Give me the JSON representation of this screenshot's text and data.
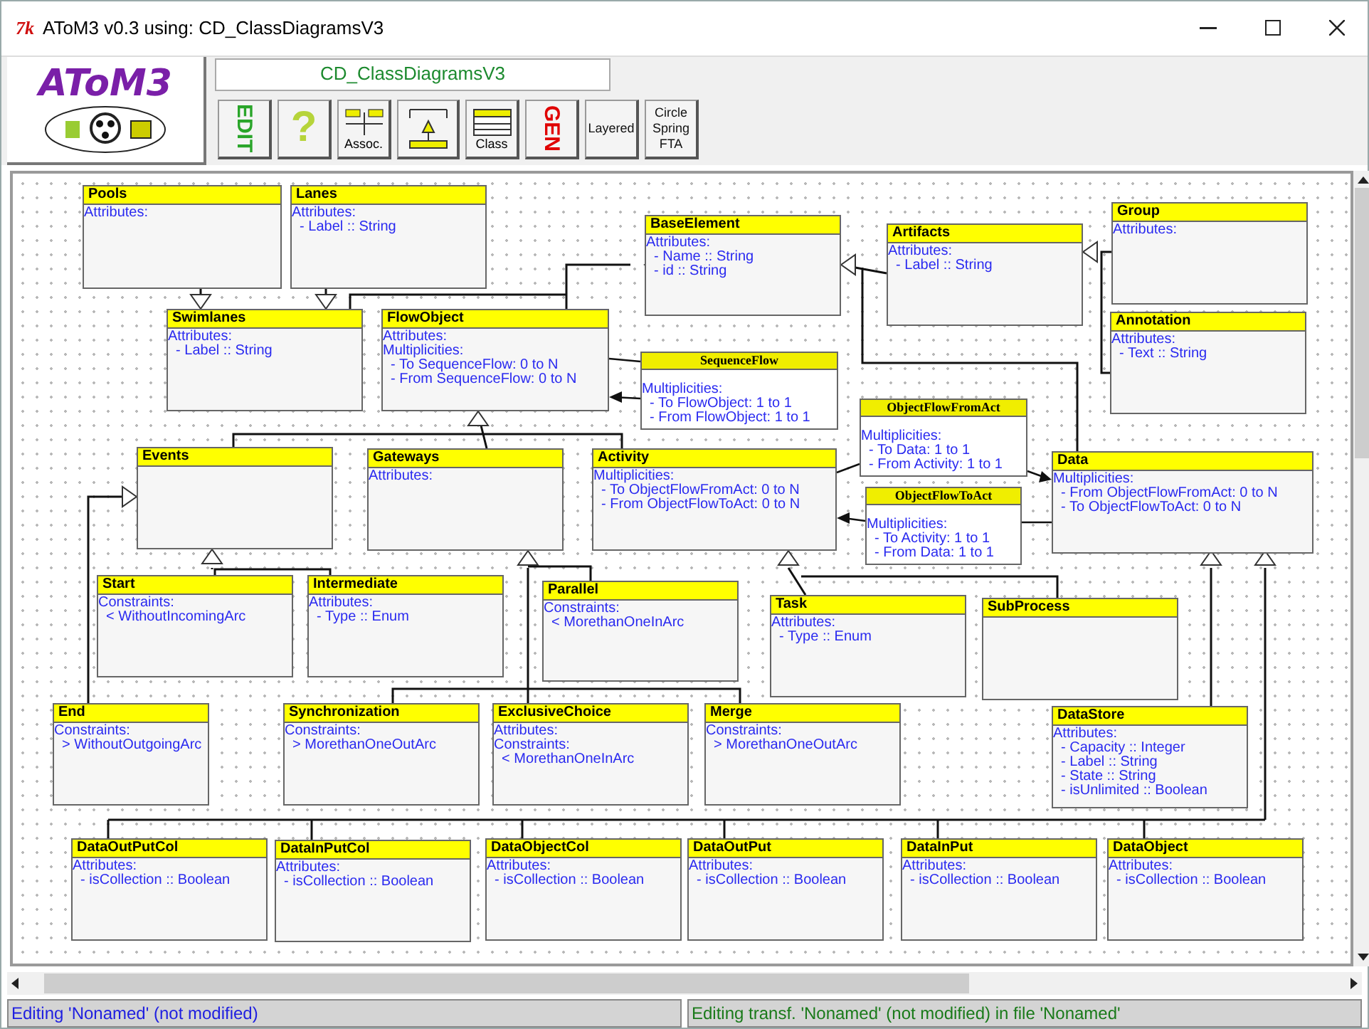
{
  "window": {
    "title": "AToM3 v0.3 using: CD_ClassDiagramsV3",
    "app_icon": "7k"
  },
  "toolbar": {
    "logo_text": "AToM3",
    "formalism": "CD_ClassDiagramsV3",
    "buttons": [
      {
        "kind": "vertical",
        "label": "EDIT"
      },
      {
        "kind": "help",
        "label": "?"
      },
      {
        "kind": "assoc",
        "label": "Assoc."
      },
      {
        "kind": "inherit"
      },
      {
        "kind": "class",
        "label": "Class"
      },
      {
        "kind": "vertical_red",
        "label": "GEN"
      },
      {
        "kind": "layout",
        "label": "Layered"
      },
      {
        "kind": "layout",
        "label": "Circle Spring FTA"
      }
    ]
  },
  "classes": [
    {
      "name": "Pools",
      "kind": "class",
      "lines": [
        "Attributes:"
      ]
    },
    {
      "name": "Lanes",
      "kind": "class",
      "lines": [
        "Attributes:",
        "  - Label :: String"
      ]
    },
    {
      "name": "BaseElement",
      "kind": "class",
      "lines": [
        "Attributes:",
        "  - Name :: String",
        "  - id :: String"
      ]
    },
    {
      "name": "Artifacts",
      "kind": "class",
      "lines": [
        "Attributes:",
        "  - Label :: String"
      ]
    },
    {
      "name": "Group",
      "kind": "class",
      "lines": [
        "Attributes:"
      ]
    },
    {
      "name": "Swimlanes",
      "kind": "class",
      "lines": [
        "Attributes:",
        "  - Label :: String"
      ]
    },
    {
      "name": "FlowObject",
      "kind": "class",
      "lines": [
        "Attributes:",
        "Multiplicities:",
        "  - To SequenceFlow: 0 to N",
        "  - From SequenceFlow: 0 to N"
      ]
    },
    {
      "name": "SequenceFlow",
      "kind": "association",
      "lines": [
        "Multiplicities:",
        "  - To FlowObject: 1 to 1",
        "  - From FlowObject: 1 to 1"
      ]
    },
    {
      "name": "Annotation",
      "kind": "class",
      "lines": [
        "Attributes:",
        "  - Text :: String"
      ]
    },
    {
      "name": "ObjectFlowFromAct",
      "kind": "association",
      "lines": [
        "Multiplicities:",
        "  - To Data: 1 to 1",
        "  - From Activity: 1 to 1"
      ]
    },
    {
      "name": "Events",
      "kind": "class"
    },
    {
      "name": "Gateways",
      "kind": "class",
      "lines": [
        "Attributes:"
      ]
    },
    {
      "name": "Activity",
      "kind": "class",
      "lines": [
        "Multiplicities:",
        "  - To ObjectFlowFromAct: 0 to N",
        "  - From ObjectFlowToAct: 0 to N"
      ]
    },
    {
      "name": "ObjectFlowToAct",
      "kind": "association",
      "lines": [
        "Multiplicities:",
        "  - To Activity: 1 to 1",
        "  - From Data: 1 to 1"
      ]
    },
    {
      "name": "Data",
      "kind": "class",
      "lines": [
        "Multiplicities:",
        "  - From ObjectFlowFromAct: 0 to N",
        "  - To ObjectFlowToAct: 0 to N"
      ]
    },
    {
      "name": "Start",
      "kind": "class",
      "lines": [
        "Constraints:",
        "  < WithoutIncomingArc"
      ]
    },
    {
      "name": "Intermediate",
      "kind": "class",
      "lines": [
        "Attributes:",
        "  - Type :: Enum"
      ]
    },
    {
      "name": "Parallel",
      "kind": "class",
      "lines": [
        "Constraints:",
        "  < MorethanOneInArc"
      ]
    },
    {
      "name": "Task",
      "kind": "class",
      "lines": [
        "Attributes:",
        "  - Type :: Enum"
      ]
    },
    {
      "name": "SubProcess",
      "kind": "class"
    },
    {
      "name": "End",
      "kind": "class",
      "lines": [
        "Constraints:",
        "  > WithoutOutgoingArc"
      ]
    },
    {
      "name": "Synchronization",
      "kind": "class",
      "lines": [
        "Constraints:",
        "  > MorethanOneOutArc"
      ]
    },
    {
      "name": "ExclusiveChoice",
      "kind": "class",
      "lines": [
        "Attributes:",
        "Constraints:",
        "  < MorethanOneInArc"
      ]
    },
    {
      "name": "Merge",
      "kind": "class",
      "lines": [
        "Constraints:",
        "  > MorethanOneOutArc"
      ]
    },
    {
      "name": "DataStore",
      "kind": "class",
      "lines": [
        "Attributes:",
        "  - Capacity :: Integer",
        "  - Label :: String",
        "  - State :: String",
        "  - isUnlimited :: Boolean"
      ]
    },
    {
      "name": "DataOutPutCol",
      "kind": "class",
      "lines": [
        "Attributes:",
        "  - isCollection :: Boolean"
      ]
    },
    {
      "name": "DataInPutCol",
      "kind": "class",
      "lines": [
        "Attributes:",
        "  - isCollection :: Boolean"
      ]
    },
    {
      "name": "DataObjectCol",
      "kind": "class",
      "lines": [
        "Attributes:",
        "  - isCollection :: Boolean"
      ]
    },
    {
      "name": "DataOutPut",
      "kind": "class",
      "lines": [
        "Attributes:",
        "  - isCollection :: Boolean"
      ]
    },
    {
      "name": "DataInPut",
      "kind": "class",
      "lines": [
        "Attributes:",
        "  - isCollection :: Boolean"
      ]
    },
    {
      "name": "DataObject",
      "kind": "class",
      "lines": [
        "Attributes:",
        "  - isCollection :: Boolean"
      ]
    }
  ],
  "status_bar": [
    "Editing 'Nonamed' (not modified)",
    "Editing transf. 'Nonamed' (not modified) in file 'Nonamed'"
  ]
}
